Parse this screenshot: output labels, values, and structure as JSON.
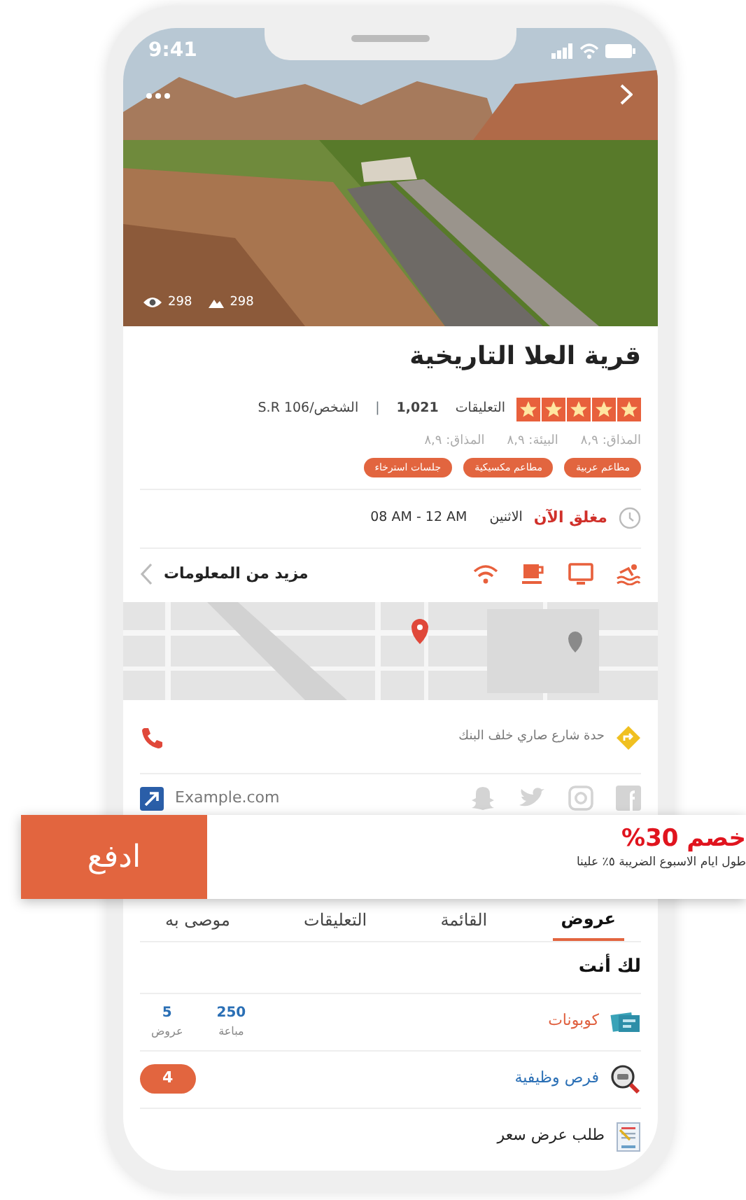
{
  "status_bar": {
    "time": "9:41"
  },
  "hero": {
    "kind": "picture",
    "view_count": "298",
    "photo_count": "298"
  },
  "place": {
    "title": "قرية العلا التاريخية",
    "stars": 5,
    "reviews_label": "التعليقات",
    "reviews_count": "1,021",
    "separator": "|",
    "price": "الشخص/106 S.R"
  },
  "ratings": [
    "المذاق: ٨,٩",
    "البيئة: ٨,٩",
    "المذاق: ٨,٩"
  ],
  "tags": [
    "مطاعم عربية",
    "مطاعم مكسيكية",
    "جلسات استرخاء"
  ],
  "hours": {
    "status": "مغلق الآن",
    "open": false,
    "day": "الاثنين",
    "time": "08 AM - 12 AM"
  },
  "more_info": "مزيد من المعلومات",
  "map": {
    "kind": "picture"
  },
  "address": "حدة شارع صاري خلف البنك",
  "website": "Example.com",
  "promo": {
    "title": "خصم 30%",
    "subtitle": "طول ايام الاسبوع الضريبة ٥٪ علينا",
    "button": "ادفع"
  },
  "tabs": [
    {
      "label": "عروض",
      "selected": true
    },
    {
      "label": "القائمة",
      "selected": false
    },
    {
      "label": "التعليقات",
      "selected": false
    },
    {
      "label": "موصى به",
      "selected": false
    }
  ],
  "for_you": {
    "title": "لك أنت",
    "items": [
      {
        "kind": "coupons",
        "label": "كوبونات",
        "color": "#e0603f",
        "stats": [
          {
            "value": "250",
            "label": "مباعة"
          },
          {
            "value": "5",
            "label": "عروض"
          }
        ]
      },
      {
        "kind": "jobs",
        "label": "فرص وظيفية",
        "color": "#2a6fb5",
        "badge": "4"
      },
      {
        "kind": "quote",
        "label": "طلب عرض سعر",
        "color": "#222222"
      }
    ]
  }
}
